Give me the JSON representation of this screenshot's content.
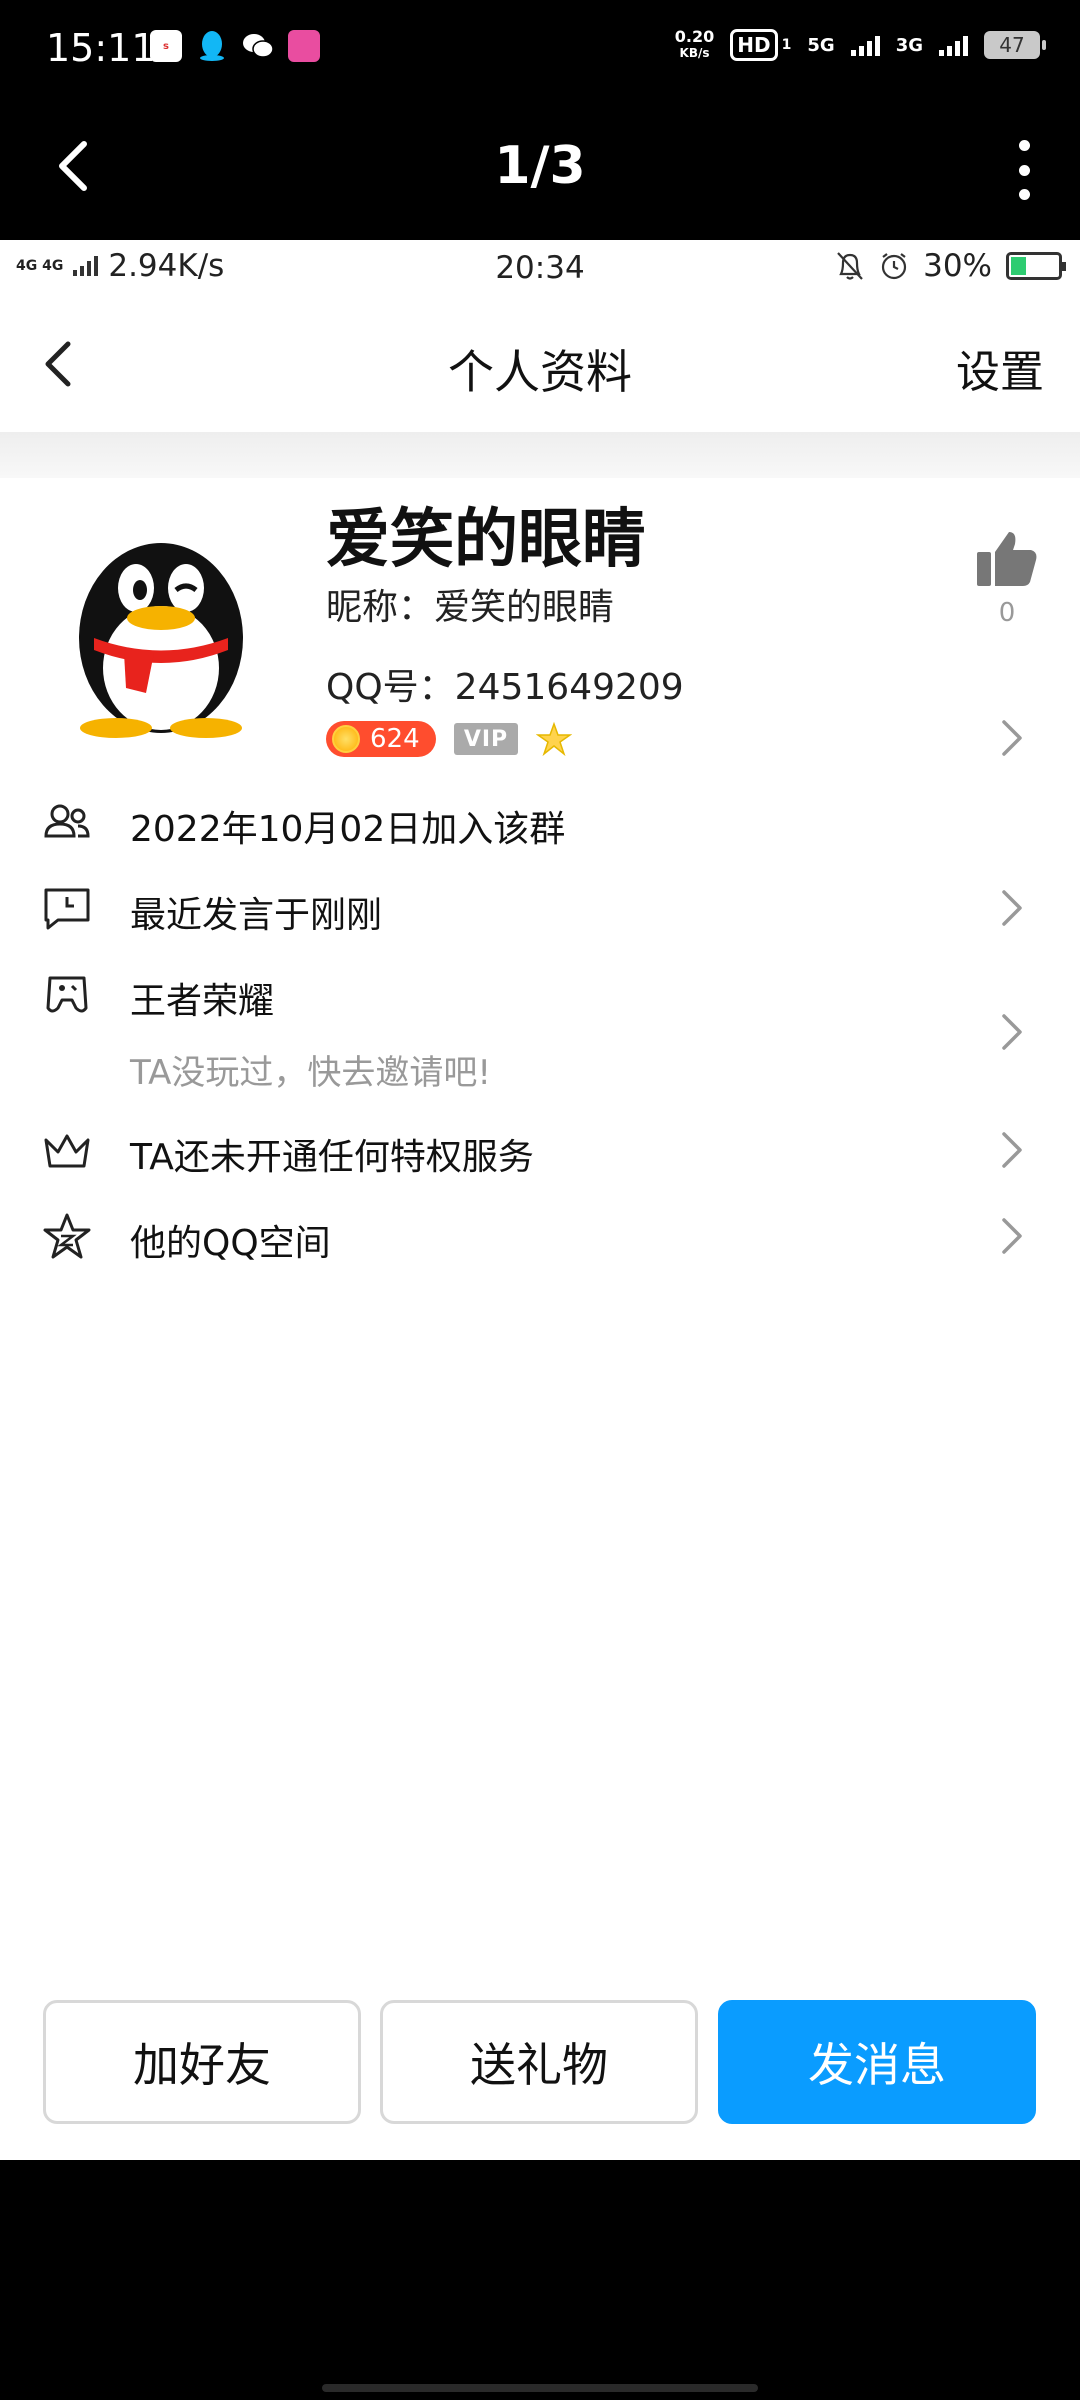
{
  "outer_status": {
    "time": "15:11",
    "net_speed_value": "0.20",
    "net_speed_unit": "KB/s",
    "hd_label": "HD",
    "hd_sub": "1",
    "sig1": "5G",
    "sig2": "3G",
    "battery": "47"
  },
  "viewer": {
    "counter": "1/3"
  },
  "inner_status": {
    "net_label": "4G 4G",
    "speed": "2.94K/s",
    "time": "20:34",
    "battery": "30%"
  },
  "header": {
    "title": "个人资料",
    "settings": "设置"
  },
  "profile": {
    "name": "爱笑的眼睛",
    "nickname": "昵称：爱笑的眼睛",
    "qq": "QQ号：2451649209",
    "coin_count": "624",
    "vip_label": "VIP",
    "like_count": "0"
  },
  "rows": [
    {
      "label": "2022年10月02日加入该群",
      "icon": "group-members-icon"
    },
    {
      "label": "最近发言于刚刚",
      "icon": "message-clock-icon"
    },
    {
      "label": "王者荣耀",
      "sub": "TA没玩过，快去邀请吧!",
      "icon": "gamepad-icon"
    },
    {
      "label": "TA还未开通任何特权服务",
      "icon": "crown-icon"
    },
    {
      "label": "他的QQ空间",
      "icon": "qzone-star-icon"
    }
  ],
  "actions": {
    "add_friend": "加好友",
    "send_gift": "送礼物",
    "send_message": "发消息"
  },
  "colors": {
    "primary": "#0a9cff",
    "coin_badge": "#ff4d2e",
    "battery_fill": "#2ecc71"
  }
}
